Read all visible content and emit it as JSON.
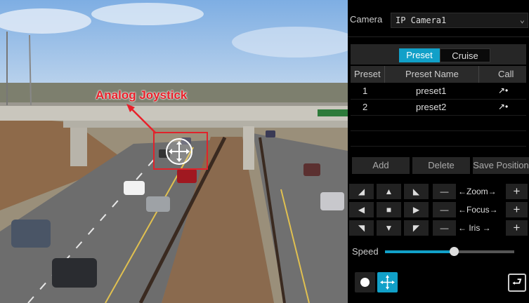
{
  "view": {
    "annotation_label": "Analog Joystick"
  },
  "panel": {
    "camera_label": "Camera",
    "camera_value": "IP Camera1",
    "tabs": {
      "preset": "Preset",
      "cruise": "Cruise"
    },
    "table": {
      "headers": [
        "Preset",
        "Preset Name",
        "Call"
      ],
      "rows": [
        {
          "index": "1",
          "name": "preset1"
        },
        {
          "index": "2",
          "name": "preset2"
        }
      ]
    },
    "buttons": {
      "add": "Add",
      "delete": "Delete",
      "save_position": "Save Position"
    },
    "lens": {
      "zoom_label": "←Zoom→",
      "focus_label": "←Focus→",
      "iris_label": "←  Iris  →"
    },
    "speed": {
      "label": "Speed",
      "level": 0.53
    }
  },
  "colors": {
    "accent": "#11a0c8",
    "annotation": "#e8202a",
    "panel_bg": "#000000"
  }
}
